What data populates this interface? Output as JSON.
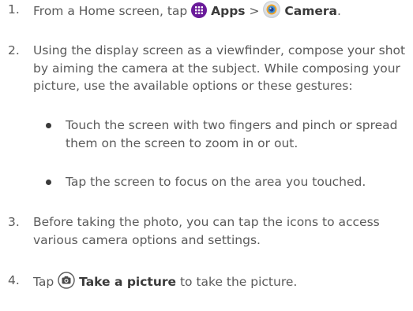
{
  "steps": [
    {
      "num": "1.",
      "prefix": "From a Home screen, tap",
      "apps": "Apps",
      "sep": ">",
      "camera": "Camera",
      "end": "."
    },
    {
      "num": "2.",
      "text": "Using the display screen as a viewfinder, compose your shot by aiming the camera at the subject. While composing your picture, use the available options or these gestures:"
    },
    {
      "num": "3.",
      "text": "Before taking the photo, you can tap the icons to access various camera options and settings."
    },
    {
      "num": "4.",
      "prefix": "Tap",
      "action": "Take a picture",
      "suffix": "to take the picture."
    }
  ],
  "bullets": [
    "Touch the screen with two fingers and pinch or spread them on the screen to zoom in or out.",
    "Tap the screen to focus on the area you touched."
  ],
  "icons": {
    "apps": "apps-grid-icon",
    "camera": "camera-app-icon",
    "shutter": "camera-shutter-icon",
    "apps_color": "#6a1b9a"
  }
}
